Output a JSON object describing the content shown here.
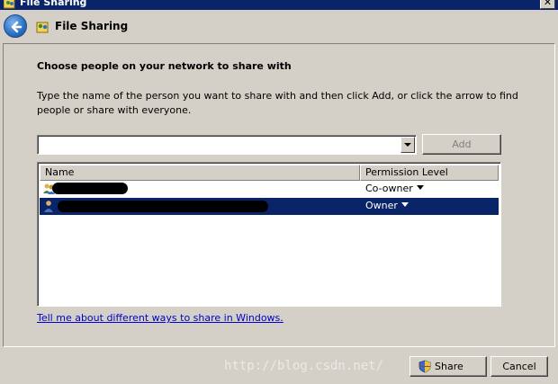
{
  "window": {
    "title": "File Sharing"
  },
  "nav": {
    "title": "File Sharing"
  },
  "main": {
    "heading": "Choose people on your network to share with",
    "description": "Type the name of the person you want to share with and then click Add, or click the arrow to find people or share with everyone.",
    "input_value": "",
    "add_label": "Add"
  },
  "list": {
    "columns": [
      "Name",
      "Permission Level"
    ],
    "rows": [
      {
        "name": "",
        "permission": "Co-owner",
        "icon": "user-group-icon",
        "selected": false
      },
      {
        "name": "",
        "permission": "Owner",
        "icon": "user-icon",
        "selected": true
      }
    ]
  },
  "help_link": "Tell me about different ways to share in Windows.",
  "footer": {
    "share_label": "Share",
    "cancel_label": "Cancel"
  },
  "watermark": "http://blog.csdn.net/",
  "colors": {
    "title_bar": "#0a246a",
    "selection": "#0a246a",
    "link": "#0000cc",
    "face": "#d4d0c8"
  }
}
